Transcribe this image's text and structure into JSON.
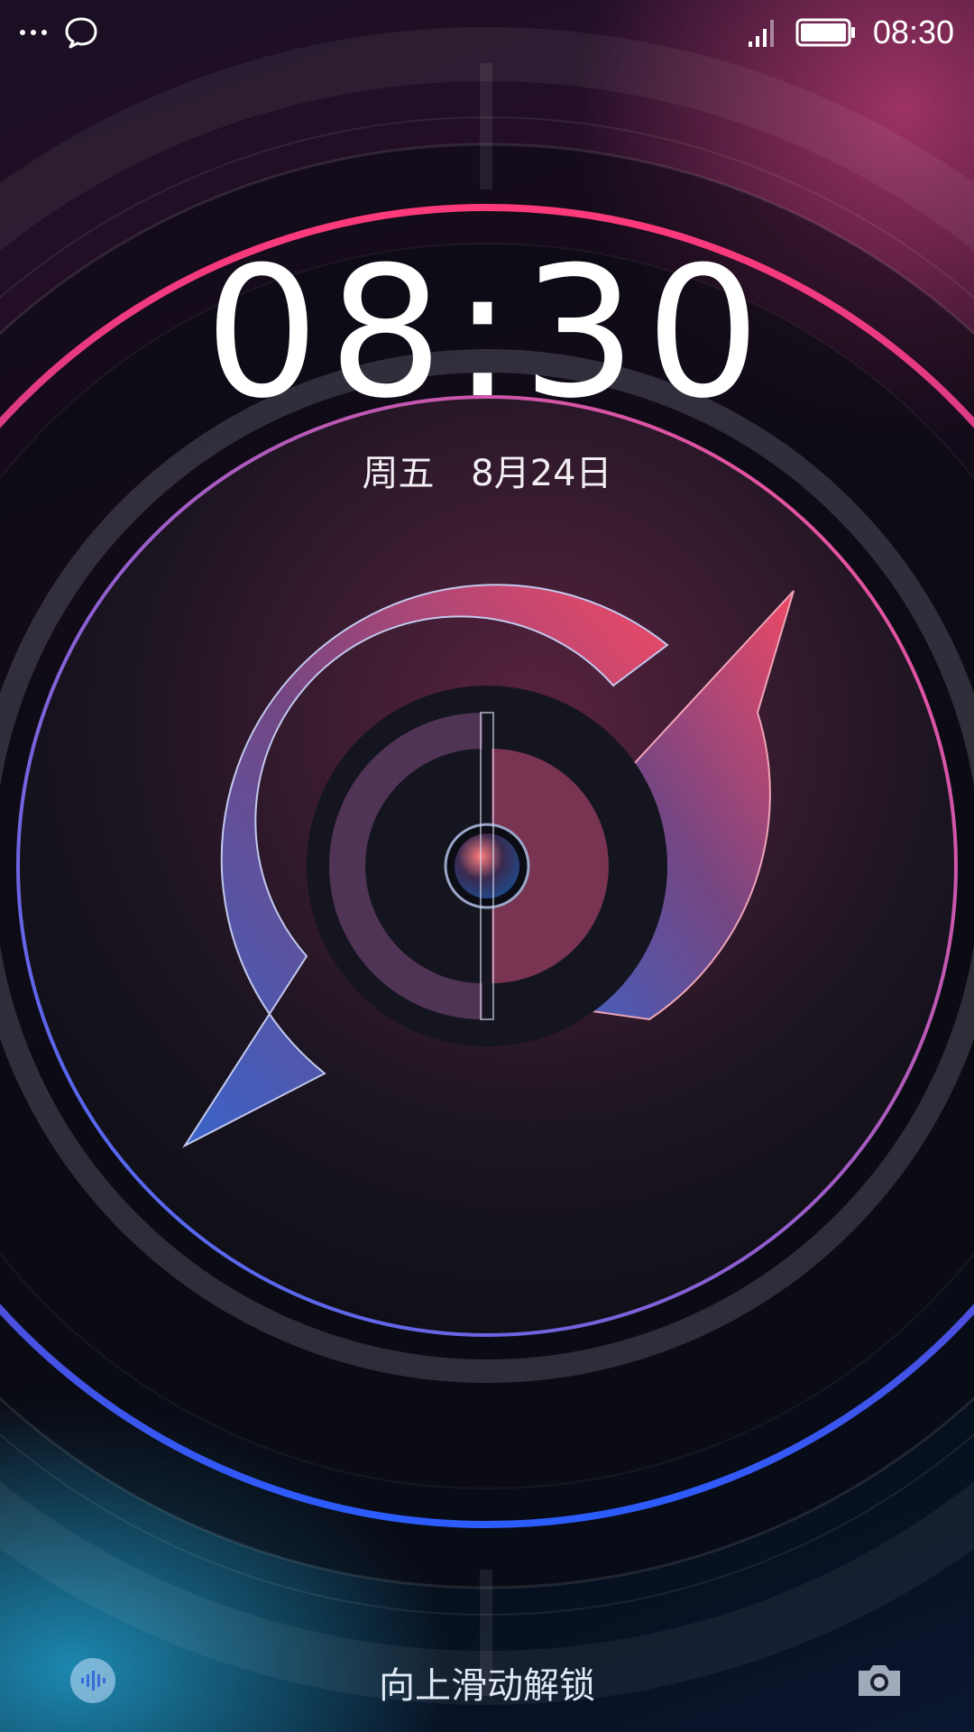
{
  "status_bar": {
    "left_icons": [
      "more-dots-icon",
      "chat-bubble-icon"
    ],
    "right_icons": [
      "signal-icon",
      "battery-icon"
    ],
    "time": "08:30"
  },
  "lockscreen": {
    "clock": "08:30",
    "weekday": "周五",
    "date": "8月24日",
    "unlock_hint": "向上滑动解锁",
    "bottom_left_icon": "voice-assistant-icon",
    "bottom_right_icon": "camera-icon"
  },
  "colors": {
    "accent_pink": "#ff3a7a",
    "accent_blue": "#2a5cff",
    "text": "#ffffff"
  }
}
